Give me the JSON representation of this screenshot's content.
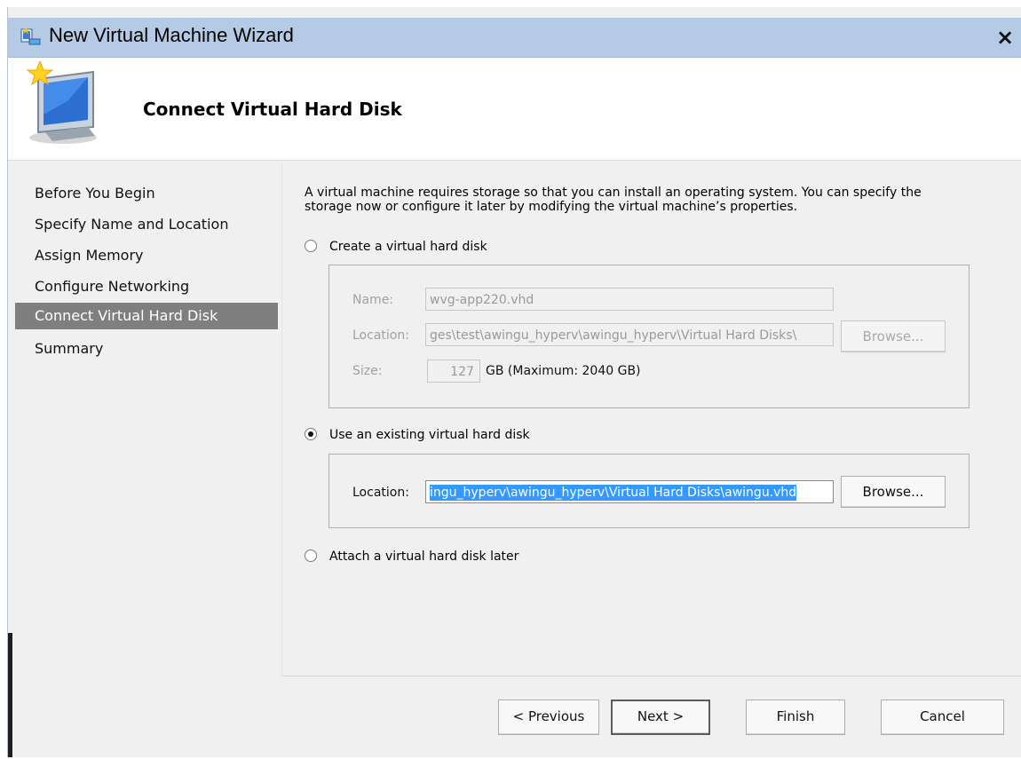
{
  "window": {
    "title": "New Virtual Machine Wizard",
    "close_label": "×"
  },
  "header": {
    "title": "Connect Virtual Hard Disk"
  },
  "nav": {
    "items": [
      {
        "label": "Before You Begin"
      },
      {
        "label": "Specify Name and Location"
      },
      {
        "label": "Assign Memory"
      },
      {
        "label": "Configure Networking"
      },
      {
        "label": "Connect Virtual Hard Disk",
        "selected": true
      },
      {
        "label": "Summary"
      }
    ]
  },
  "content": {
    "intro_line1": "A virtual machine requires storage so that you can install an operating system. You can specify the",
    "intro_line2": "storage now or configure it later by modifying the virtual machine’s properties.",
    "create_option": {
      "label": "Create a virtual hard disk",
      "checked": false,
      "name_label": "Name:",
      "name_value": "wvg-app220.vhd",
      "location_label": "Location:",
      "location_value": "ges\\test\\awingu_hyperv\\awingu_hyperv\\Virtual Hard Disks\\",
      "browse_label": "Browse...",
      "size_label": "Size:",
      "size_value": "127",
      "size_hint": "GB (Maximum: 2040 GB)"
    },
    "existing_option": {
      "label": "Use an existing virtual hard disk",
      "checked": true,
      "location_label": "Location:",
      "location_value": "ingu_hyperv\\awingu_hyperv\\Virtual Hard Disks\\awingu.vhd",
      "browse_label": "Browse..."
    },
    "later_option": {
      "label": "Attach a virtual hard disk later",
      "checked": false
    }
  },
  "footer": {
    "previous_label": "< Previous",
    "next_label": "Next >",
    "finish_label": "Finish",
    "cancel_label": "Cancel"
  }
}
